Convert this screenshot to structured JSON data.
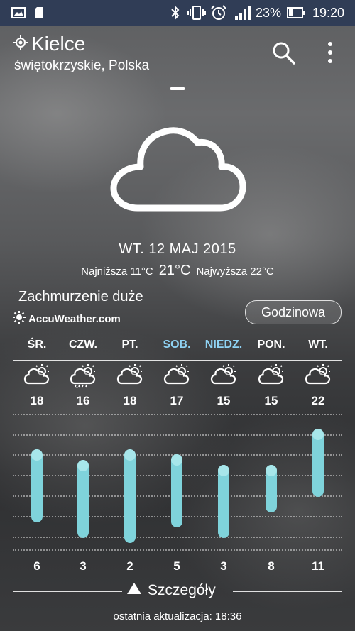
{
  "status_bar": {
    "battery": "23%",
    "time": "19:20"
  },
  "header": {
    "city": "Kielce",
    "region": "świętokrzyskie, Polska"
  },
  "current": {
    "date": "WT. 12 MAJ 2015",
    "low_label": "Najniższa 11°C",
    "temp": "21°C",
    "high_label": "Najwyższa 22°C",
    "condition": "Zachmurzenie duże",
    "provider": "AccuWeather.com",
    "hourly_button": "Godzinowa"
  },
  "forecast": {
    "colors": {
      "weekday": "#ffffff",
      "weekend": "#8fd3f4",
      "bar": "#7fd3db"
    },
    "days": [
      {
        "day": "ŚR.",
        "high": "18",
        "low": "6",
        "weekend": false,
        "icon": "partly-cloudy-icon"
      },
      {
        "day": "CZW.",
        "high": "16",
        "low": "3",
        "weekend": false,
        "icon": "showers-icon"
      },
      {
        "day": "PT.",
        "high": "18",
        "low": "2",
        "weekend": false,
        "icon": "partly-sunny-icon"
      },
      {
        "day": "SOB.",
        "high": "17",
        "low": "5",
        "weekend": true,
        "icon": "partly-cloudy-icon"
      },
      {
        "day": "NIEDZ.",
        "high": "15",
        "low": "3",
        "weekend": true,
        "icon": "partly-cloudy-icon"
      },
      {
        "day": "PON.",
        "high": "15",
        "low": "8",
        "weekend": false,
        "icon": "partly-cloudy-icon"
      },
      {
        "day": "WT.",
        "high": "22",
        "low": "11",
        "weekend": false,
        "icon": "partly-cloudy-icon"
      }
    ]
  },
  "footer": {
    "details_label": "Szczegóły",
    "last_update": "ostatnia aktualizacja: 18:36"
  }
}
